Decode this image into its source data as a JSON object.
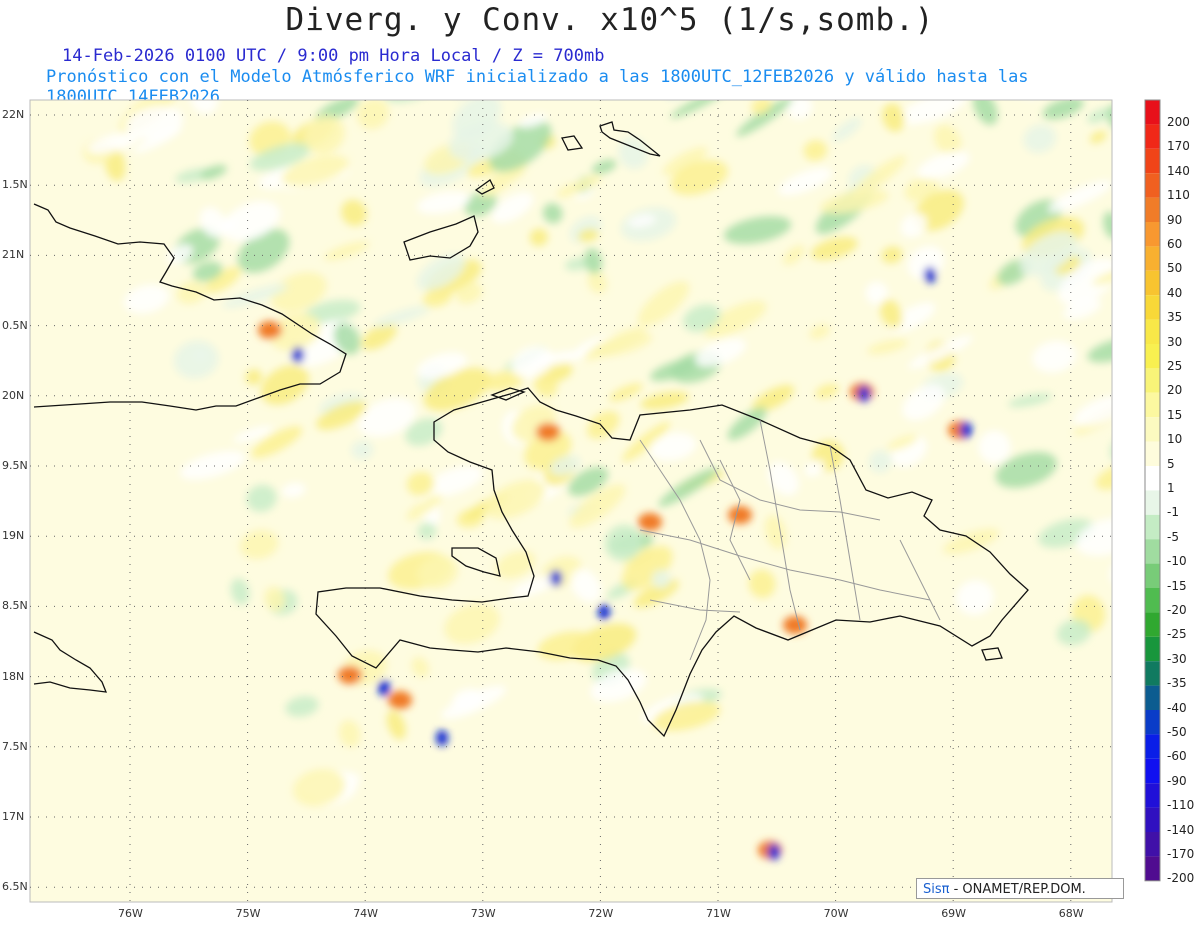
{
  "header": {
    "title": "Diverg. y Conv. x10^5 (1/s,somb.)",
    "valid_line": "14-Feb-2026  0100 UTC / 9:00 pm Hora Local / Z = 700mb",
    "model_line": "Pronóstico con el Modelo Atmósferico WRF inicializado a las 1800UTC_12FEB2026 y válido hasta las  1800UTC_14FEB2026"
  },
  "axes": {
    "lat_labels": [
      "22N",
      "1.5N",
      "21N",
      "0.5N",
      "20N",
      "9.5N",
      "19N",
      "8.5N",
      "18N",
      "7.5N",
      "17N",
      "6.5N"
    ],
    "lon_labels": [
      "76W",
      "75W",
      "74W",
      "73W",
      "72W",
      "71W",
      "70W",
      "69W",
      "68W"
    ]
  },
  "colorbar": {
    "labels": [
      "200",
      "170",
      "140",
      "110",
      "90",
      "60",
      "50",
      "40",
      "35",
      "30",
      "25",
      "20",
      "15",
      "10",
      "5",
      "1",
      "-1",
      "-5",
      "-10",
      "-15",
      "-20",
      "-25",
      "-30",
      "-35",
      "-40",
      "-50",
      "-60",
      "-90",
      "-110",
      "-140",
      "-170",
      "-200"
    ],
    "colors": [
      "#e8101a",
      "#f02818",
      "#f04418",
      "#f06020",
      "#f07c28",
      "#f89830",
      "#f8b030",
      "#f8c430",
      "#f8d838",
      "#f8e848",
      "#f8f050",
      "#f8f478",
      "#fcf8a0",
      "#fcfac0",
      "#fefcdc",
      "#ffffff",
      "#e8f6e8",
      "#c4ecc4",
      "#a0dca0",
      "#78cc78",
      "#50bc50",
      "#30a830",
      "#18963c",
      "#107a60",
      "#0c5c90",
      "#0a3cc8",
      "#0a1ee8",
      "#1010f0",
      "#2010d8",
      "#3010c0",
      "#4010a8",
      "#500c90"
    ]
  },
  "credit": {
    "sis": "Sisπ",
    "rest": " - ONAMET/REP.DOM."
  }
}
